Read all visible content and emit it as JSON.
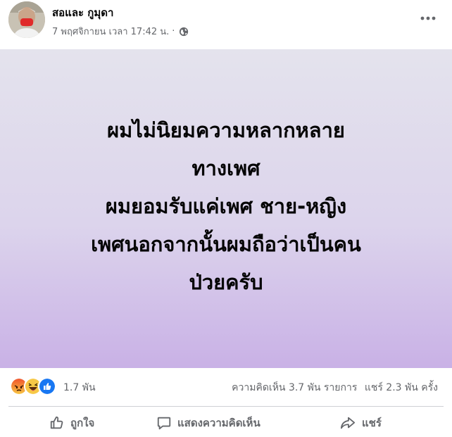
{
  "post": {
    "author": "สอและ กูมุดา",
    "timestamp": "7 พฤศจิกายน เวลา 17:42 น.",
    "separator": "·",
    "privacy_icon": "globe-icon",
    "more_icon": "more-horizontal-icon",
    "content_lines": [
      "ผมไม่นิยมความหลากหลาย",
      "ทางเพศ",
      "ผมยอมรับแค่เพศ ชาย-หญิง",
      "เพศนอกจากนั้นผมถือว่าเป็นคน",
      "ป่วยครับ"
    ],
    "background_colors": [
      "#e4e3ed",
      "#c9b1e6"
    ]
  },
  "reactions": {
    "icons": [
      "angry-icon",
      "haha-icon",
      "like-icon"
    ],
    "count": "1.7 พัน",
    "comments": "ความคิดเห็น 3.7 พัน รายการ",
    "shares": "แชร์ 2.3 พัน ครั้ง"
  },
  "actions": {
    "like": "ถูกใจ",
    "comment": "แสดงความคิดเห็น",
    "share": "แชร์"
  }
}
